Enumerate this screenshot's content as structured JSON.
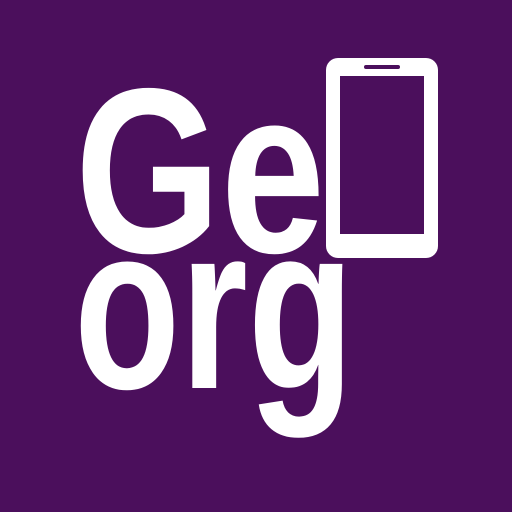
{
  "logo": {
    "line1": "Ge",
    "line2": "org",
    "icon": "smartphone-icon",
    "colors": {
      "background": "#4b0f5c",
      "foreground": "#ffffff"
    }
  }
}
